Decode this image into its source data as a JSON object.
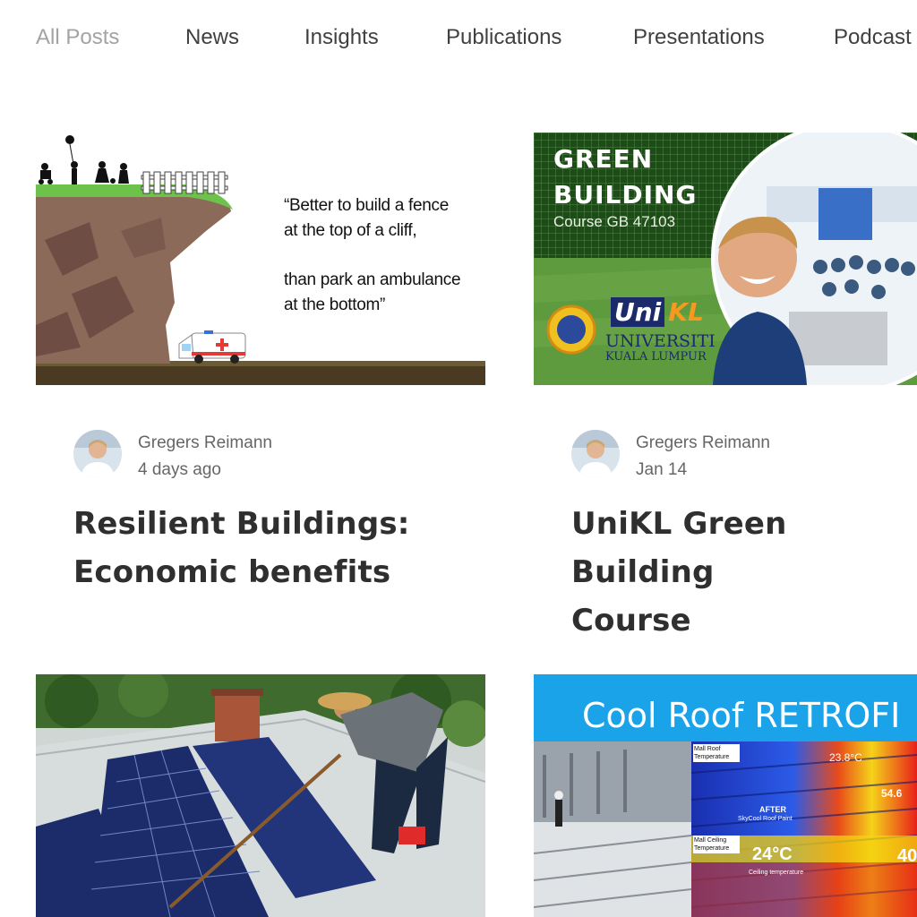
{
  "nav": {
    "items": [
      "All Posts",
      "News",
      "Insights",
      "Publications",
      "Presentations",
      "Podcast"
    ],
    "active_index": 0
  },
  "posts": [
    {
      "author": "Gregers Reimann",
      "date": "4 days ago",
      "title_line1": "Resilient Buildings:",
      "title_line2": "Economic benefits",
      "cover": {
        "quote_line1": "“Better to build a fence",
        "quote_line2": "at the top of  a cliff,",
        "quote_line3": "than park an ambulance",
        "quote_line4": "at the bottom”"
      }
    },
    {
      "author": "Gregers Reimann",
      "date": "Jan 14",
      "title_line1": "UniKL Green Building",
      "title_line2": "Course",
      "cover": {
        "heading1": "GREEN",
        "heading2": "BUILDING",
        "course": "Course GB 47103",
        "logo_uni": "Uni",
        "logo_kl": "KL",
        "uni_name1": "UNIVERSITI",
        "uni_name2": "KUALA LUMPUR"
      }
    },
    {
      "cover": {
        "description_icon": "solar-panel-cleaning-photo"
      }
    },
    {
      "cover": {
        "heading": "Cool Roof RETROFI",
        "label_roof_temp": "Mall Roof Temperature",
        "label_ceiling_temp": "Mall Ceiling Temperature",
        "temp_roof": "23.8°C",
        "temp_ceiling": "24°C",
        "temp_right_top": "54.6",
        "temp_right_bottom": "40",
        "after_label": "AFTER",
        "paint_label": "SkyCool Roof Paint",
        "ceiling_label": "Ceiling temperature"
      }
    }
  ],
  "colors": {
    "nav_active": "#a3a3a3",
    "nav_text": "#404040",
    "title": "#2f2f2f",
    "meta": "#666666",
    "grass": "#6dc24b",
    "cliff": "#8c6a5a",
    "cool_roof_blue": "#1aa3e8",
    "unikl_orange": "#f39a1f"
  }
}
